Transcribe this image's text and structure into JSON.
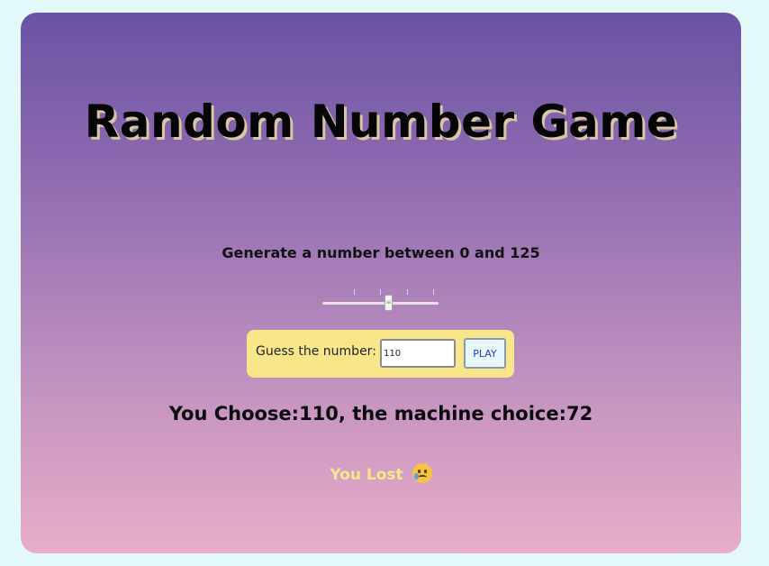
{
  "title": "Random Number Game",
  "range_label": "Generate a number between 0 and 125",
  "slider": {
    "min": 0,
    "max": 125,
    "value": 72
  },
  "guess": {
    "label": "Guess the number:",
    "value": "110",
    "button_label": "PLAY"
  },
  "result_text": "You Choose:110, the machine choice:72",
  "outcome_text": "You Lost",
  "outcome_icon": "sad-tear-face-icon",
  "colors": {
    "page_bg": "#e2f8f9",
    "gradient_top": "#6a52a4",
    "gradient_bottom": "#e9adc8",
    "guess_box_bg": "#f7e68a",
    "outcome_text": "#f7e68a",
    "button_text": "#2b3da7"
  }
}
